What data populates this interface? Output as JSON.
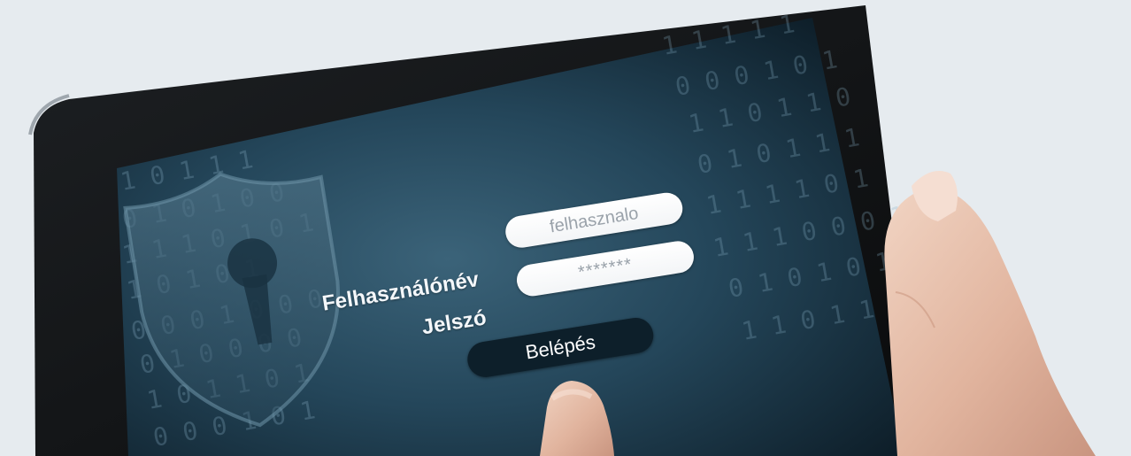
{
  "login": {
    "username_label": "Felhasználónév",
    "username_value": "felhasznalo",
    "password_label": "Jelszó",
    "password_value": "*******",
    "button_label": "Belépés"
  },
  "background": {
    "binary_rows": [
      "1 0 1 1 1",
      "0 1 0 1 0 0",
      "1 1 1 0 1 0 1",
      "1 0 1 0 1",
      "0 0 0 1 0 0 0",
      "0 1 0 0 0 0",
      "1 0 1 1 0 1",
      "0 0 0 1 0 1",
      "1 1 1 1 1",
      "0 0 0 1 0 1",
      "1 1 0 1 1 0",
      "0 1 0 1 1 1",
      "1 1 1 1 0 1",
      "1 1 1 0 0 0 1",
      "0 1 0 1 0 1",
      "1 1 0 1 1 0"
    ]
  },
  "colors": {
    "bezel": "#121416",
    "screen_dark": "#0b1a24",
    "screen_mid": "#274a5f",
    "screen_light": "#3a6278",
    "field": "#ffffff",
    "button": "#0d1f2a",
    "text_light": "#f4f7fa",
    "placeholder": "#9aa2aa"
  },
  "icons": {
    "shield": "shield-lock-icon"
  }
}
